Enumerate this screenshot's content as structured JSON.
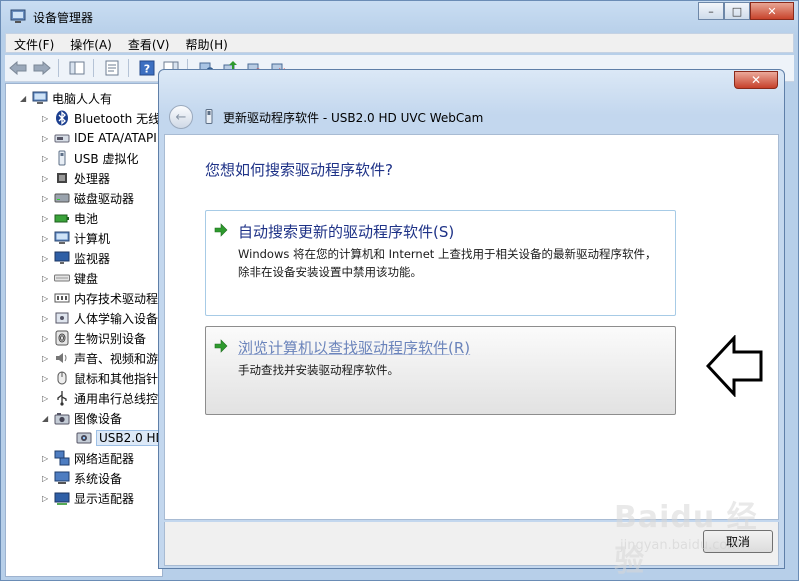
{
  "window": {
    "title": "设备管理器",
    "min": "–",
    "max": "□",
    "close": "✕"
  },
  "menu": [
    "文件(F)",
    "操作(A)",
    "查看(V)",
    "帮助(H)"
  ],
  "tree": [
    {
      "label": "电脑人人有",
      "icon": "computer-icon",
      "expander": "◢",
      "indent": 0
    },
    {
      "label": "Bluetooth 无线",
      "icon": "bluetooth-icon",
      "expander": "▷",
      "indent": 1
    },
    {
      "label": "IDE ATA/ATAPI",
      "icon": "ide-controller-icon",
      "expander": "▷",
      "indent": 1
    },
    {
      "label": "USB 虚拟化",
      "icon": "usb-icon",
      "expander": "▷",
      "indent": 1
    },
    {
      "label": "处理器",
      "icon": "processor-icon",
      "expander": "▷",
      "indent": 1
    },
    {
      "label": "磁盘驱动器",
      "icon": "disk-drive-icon",
      "expander": "▷",
      "indent": 1
    },
    {
      "label": "电池",
      "icon": "battery-icon",
      "expander": "▷",
      "indent": 1
    },
    {
      "label": "计算机",
      "icon": "computer-icon",
      "expander": "▷",
      "indent": 1
    },
    {
      "label": "监视器",
      "icon": "monitor-icon",
      "expander": "▷",
      "indent": 1
    },
    {
      "label": "键盘",
      "icon": "keyboard-icon",
      "expander": "▷",
      "indent": 1
    },
    {
      "label": "内存技术驱动程",
      "icon": "memory-icon",
      "expander": "▷",
      "indent": 1
    },
    {
      "label": "人体学输入设备",
      "icon": "hid-icon",
      "expander": "▷",
      "indent": 1
    },
    {
      "label": "生物识别设备",
      "icon": "fingerprint-icon",
      "expander": "▷",
      "indent": 1
    },
    {
      "label": "声音、视频和游",
      "icon": "speaker-icon",
      "expander": "▷",
      "indent": 1
    },
    {
      "label": "鼠标和其他指针",
      "icon": "mouse-icon",
      "expander": "▷",
      "indent": 1
    },
    {
      "label": "通用串行总线控",
      "icon": "usb-controller-icon",
      "expander": "▷",
      "indent": 1
    },
    {
      "label": "图像设备",
      "icon": "camera-icon",
      "expander": "◢",
      "indent": 1
    },
    {
      "label": "USB2.0 HD",
      "icon": "webcam-icon",
      "expander": "",
      "indent": 2,
      "selected": true
    },
    {
      "label": "网络适配器",
      "icon": "network-icon",
      "expander": "▷",
      "indent": 1
    },
    {
      "label": "系统设备",
      "icon": "system-icon",
      "expander": "▷",
      "indent": 1
    },
    {
      "label": "显示适配器",
      "icon": "display-adapter-icon",
      "expander": "▷",
      "indent": 1
    }
  ],
  "dialog": {
    "title": "更新驱动程序软件 - USB2.0 HD UVC WebCam",
    "close": "✕",
    "back": "←",
    "question": "您想如何搜索驱动程序软件?",
    "option_auto": {
      "title": "自动搜索更新的驱动程序软件(S)",
      "desc": "Windows 将在您的计算机和 Internet 上查找用于相关设备的最新驱动程序软件，除非在设备安装设置中禁用该功能。"
    },
    "option_browse": {
      "title": "浏览计算机以查找驱动程序软件(R)",
      "desc": "手动查找并安装驱动程序软件。"
    },
    "cancel": "取消"
  },
  "watermark": {
    "line1": "Baidu 经验",
    "line2": "jingyan.baidu.com"
  },
  "colors": {
    "accent_blue": "#1e3287",
    "green_arrow": "#2e9a2e",
    "title_bar": "#c9ddf2"
  }
}
